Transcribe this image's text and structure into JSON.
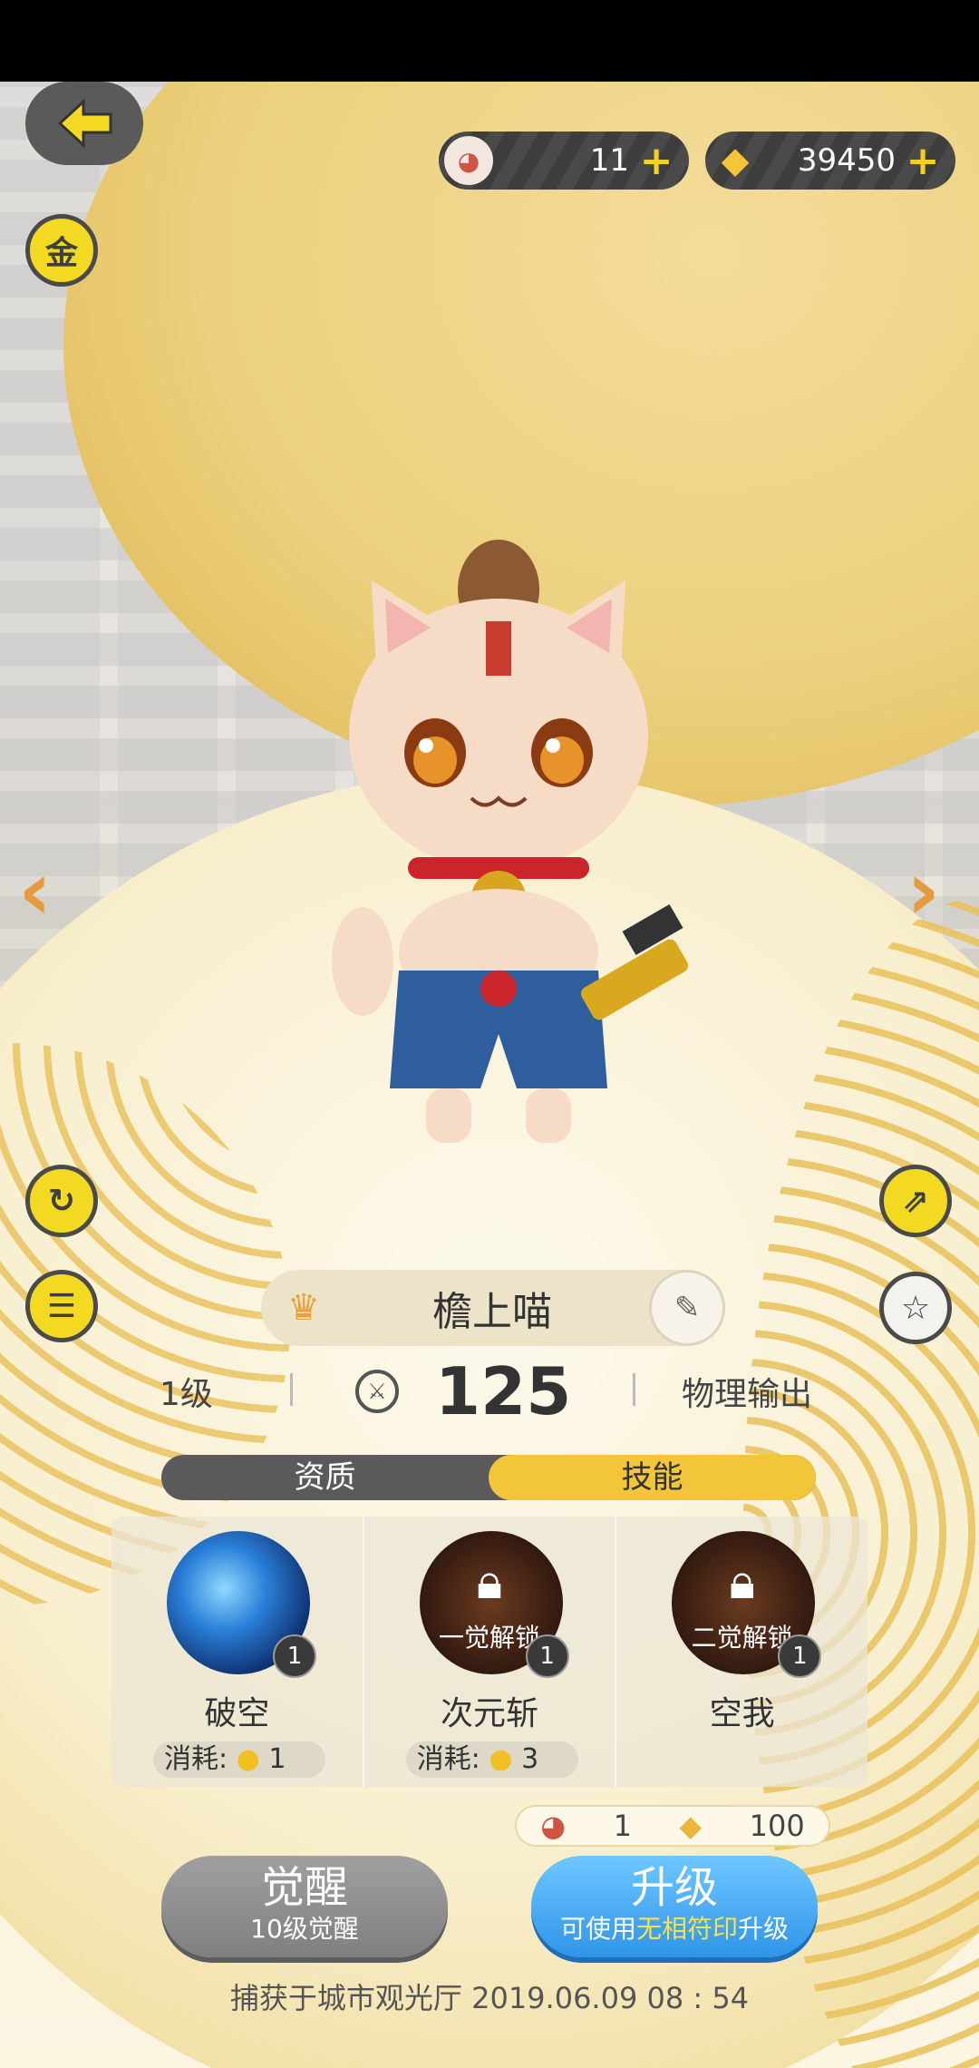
{
  "resources": {
    "tickets": {
      "icon": "cat-face-icon",
      "value": "11"
    },
    "crystals": {
      "icon": "gold-crystal-icon",
      "value": "39450"
    }
  },
  "left_buttons": {
    "gold": "金"
  },
  "character": {
    "name": "檐上喵",
    "level": "1级",
    "power": "125",
    "role": "物理输出"
  },
  "tabs": [
    {
      "label": "资质",
      "active": false
    },
    {
      "label": "技能",
      "active": true
    }
  ],
  "skills": [
    {
      "name": "破空",
      "level": "1",
      "locked": false,
      "cost_label": "消耗:",
      "cost": "1"
    },
    {
      "name": "次元斩",
      "level": "1",
      "locked": true,
      "lock_text": "一觉解锁",
      "cost_label": "消耗:",
      "cost": "3"
    },
    {
      "name": "空我",
      "level": "1",
      "locked": true,
      "lock_text": "二觉解锁"
    }
  ],
  "upgrade_cost": {
    "tickets": "1",
    "crystals": "100"
  },
  "buttons": {
    "awaken": {
      "label": "觉醒",
      "sub": "10级觉醒"
    },
    "upgrade": {
      "label": "升级",
      "sub_pre": "可使用",
      "sub_hl": "无相符印",
      "sub_post": "升级"
    }
  },
  "capture_info": "捕获于城市观光厅  2019.06.09   08 : 54",
  "colors": {
    "accent_yellow": "#f3d921",
    "upgrade_blue": "#3a9ef0",
    "awaken_gray": "#8c8c8c"
  }
}
